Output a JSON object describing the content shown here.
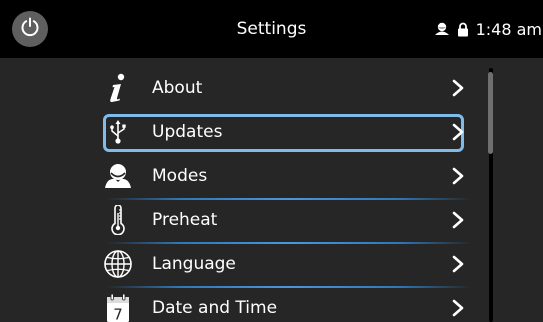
{
  "header": {
    "title": "Settings",
    "time": "1:48 am",
    "power_icon": "power-icon",
    "user_icon": "user-icon",
    "lock_icon": "lock-icon"
  },
  "menu": {
    "items": [
      {
        "label": "About",
        "icon": "info-icon"
      },
      {
        "label": "Updates",
        "icon": "usb-icon",
        "selected": true
      },
      {
        "label": "Modes",
        "icon": "person-icon"
      },
      {
        "label": "Preheat",
        "icon": "thermometer-icon"
      },
      {
        "label": "Language",
        "icon": "globe-icon"
      },
      {
        "label": "Date and Time",
        "icon": "calendar-icon",
        "calendar_day": "7"
      }
    ]
  },
  "colors": {
    "background": "#262626",
    "topbar": "#000000",
    "selection": "#7fbcea",
    "divider": "#2e78b8"
  }
}
